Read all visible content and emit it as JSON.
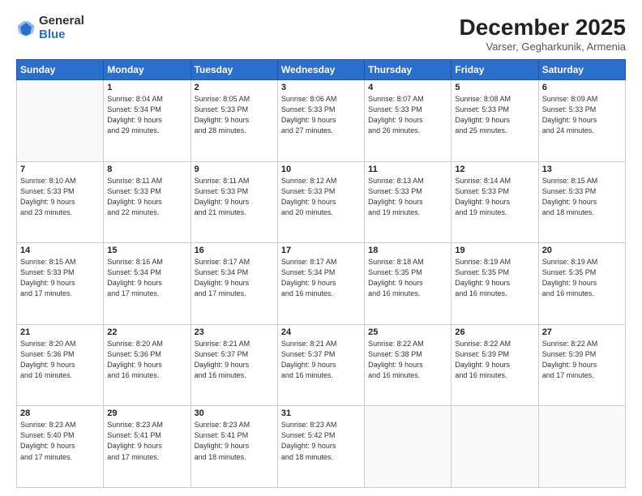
{
  "logo": {
    "general": "General",
    "blue": "Blue"
  },
  "header": {
    "month": "December 2025",
    "location": "Varser, Gegharkunik, Armenia"
  },
  "weekdays": [
    "Sunday",
    "Monday",
    "Tuesday",
    "Wednesday",
    "Thursday",
    "Friday",
    "Saturday"
  ],
  "weeks": [
    [
      {
        "day": "",
        "info": ""
      },
      {
        "day": "1",
        "info": "Sunrise: 8:04 AM\nSunset: 5:34 PM\nDaylight: 9 hours\nand 29 minutes."
      },
      {
        "day": "2",
        "info": "Sunrise: 8:05 AM\nSunset: 5:33 PM\nDaylight: 9 hours\nand 28 minutes."
      },
      {
        "day": "3",
        "info": "Sunrise: 8:06 AM\nSunset: 5:33 PM\nDaylight: 9 hours\nand 27 minutes."
      },
      {
        "day": "4",
        "info": "Sunrise: 8:07 AM\nSunset: 5:33 PM\nDaylight: 9 hours\nand 26 minutes."
      },
      {
        "day": "5",
        "info": "Sunrise: 8:08 AM\nSunset: 5:33 PM\nDaylight: 9 hours\nand 25 minutes."
      },
      {
        "day": "6",
        "info": "Sunrise: 8:09 AM\nSunset: 5:33 PM\nDaylight: 9 hours\nand 24 minutes."
      }
    ],
    [
      {
        "day": "7",
        "info": "Sunrise: 8:10 AM\nSunset: 5:33 PM\nDaylight: 9 hours\nand 23 minutes."
      },
      {
        "day": "8",
        "info": "Sunrise: 8:11 AM\nSunset: 5:33 PM\nDaylight: 9 hours\nand 22 minutes."
      },
      {
        "day": "9",
        "info": "Sunrise: 8:11 AM\nSunset: 5:33 PM\nDaylight: 9 hours\nand 21 minutes."
      },
      {
        "day": "10",
        "info": "Sunrise: 8:12 AM\nSunset: 5:33 PM\nDaylight: 9 hours\nand 20 minutes."
      },
      {
        "day": "11",
        "info": "Sunrise: 8:13 AM\nSunset: 5:33 PM\nDaylight: 9 hours\nand 19 minutes."
      },
      {
        "day": "12",
        "info": "Sunrise: 8:14 AM\nSunset: 5:33 PM\nDaylight: 9 hours\nand 19 minutes."
      },
      {
        "day": "13",
        "info": "Sunrise: 8:15 AM\nSunset: 5:33 PM\nDaylight: 9 hours\nand 18 minutes."
      }
    ],
    [
      {
        "day": "14",
        "info": "Sunrise: 8:15 AM\nSunset: 5:33 PM\nDaylight: 9 hours\nand 17 minutes."
      },
      {
        "day": "15",
        "info": "Sunrise: 8:16 AM\nSunset: 5:34 PM\nDaylight: 9 hours\nand 17 minutes."
      },
      {
        "day": "16",
        "info": "Sunrise: 8:17 AM\nSunset: 5:34 PM\nDaylight: 9 hours\nand 17 minutes."
      },
      {
        "day": "17",
        "info": "Sunrise: 8:17 AM\nSunset: 5:34 PM\nDaylight: 9 hours\nand 16 minutes."
      },
      {
        "day": "18",
        "info": "Sunrise: 8:18 AM\nSunset: 5:35 PM\nDaylight: 9 hours\nand 16 minutes."
      },
      {
        "day": "19",
        "info": "Sunrise: 8:19 AM\nSunset: 5:35 PM\nDaylight: 9 hours\nand 16 minutes."
      },
      {
        "day": "20",
        "info": "Sunrise: 8:19 AM\nSunset: 5:35 PM\nDaylight: 9 hours\nand 16 minutes."
      }
    ],
    [
      {
        "day": "21",
        "info": "Sunrise: 8:20 AM\nSunset: 5:36 PM\nDaylight: 9 hours\nand 16 minutes."
      },
      {
        "day": "22",
        "info": "Sunrise: 8:20 AM\nSunset: 5:36 PM\nDaylight: 9 hours\nand 16 minutes."
      },
      {
        "day": "23",
        "info": "Sunrise: 8:21 AM\nSunset: 5:37 PM\nDaylight: 9 hours\nand 16 minutes."
      },
      {
        "day": "24",
        "info": "Sunrise: 8:21 AM\nSunset: 5:37 PM\nDaylight: 9 hours\nand 16 minutes."
      },
      {
        "day": "25",
        "info": "Sunrise: 8:22 AM\nSunset: 5:38 PM\nDaylight: 9 hours\nand 16 minutes."
      },
      {
        "day": "26",
        "info": "Sunrise: 8:22 AM\nSunset: 5:39 PM\nDaylight: 9 hours\nand 16 minutes."
      },
      {
        "day": "27",
        "info": "Sunrise: 8:22 AM\nSunset: 5:39 PM\nDaylight: 9 hours\nand 17 minutes."
      }
    ],
    [
      {
        "day": "28",
        "info": "Sunrise: 8:23 AM\nSunset: 5:40 PM\nDaylight: 9 hours\nand 17 minutes."
      },
      {
        "day": "29",
        "info": "Sunrise: 8:23 AM\nSunset: 5:41 PM\nDaylight: 9 hours\nand 17 minutes."
      },
      {
        "day": "30",
        "info": "Sunrise: 8:23 AM\nSunset: 5:41 PM\nDaylight: 9 hours\nand 18 minutes."
      },
      {
        "day": "31",
        "info": "Sunrise: 8:23 AM\nSunset: 5:42 PM\nDaylight: 9 hours\nand 18 minutes."
      },
      {
        "day": "",
        "info": ""
      },
      {
        "day": "",
        "info": ""
      },
      {
        "day": "",
        "info": ""
      }
    ]
  ]
}
